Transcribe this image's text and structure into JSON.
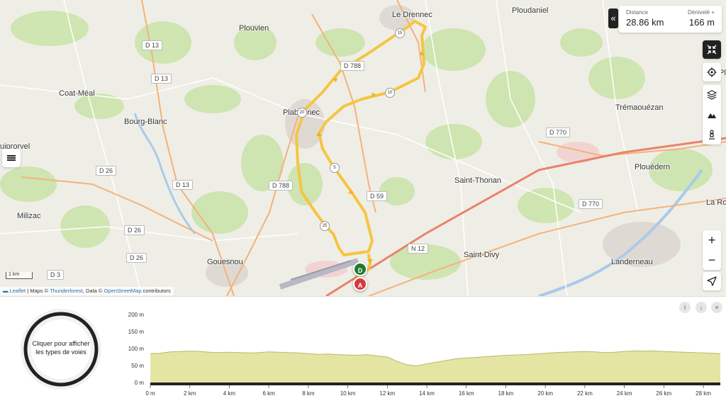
{
  "map": {
    "places": [
      {
        "name": "Le Drennec",
        "cls": "pl-drennec"
      },
      {
        "name": "Ploudaniel",
        "cls": "pl-ploudaniel"
      },
      {
        "name": "Plouvien",
        "cls": "pl-plouvien"
      },
      {
        "name": "Coat-Méal",
        "cls": "pl-coatmeal"
      },
      {
        "name": "Bourg-Blanc",
        "cls": "pl-bourgblanc"
      },
      {
        "name": "uiprorvel",
        "cls": "pl-uiprorvel"
      },
      {
        "name": "Plabennec",
        "cls": "pl-plabennec"
      },
      {
        "name": "Trémaouézan",
        "cls": "pl-tremaouezan"
      },
      {
        "name": "Plouédern",
        "cls": "pl-plouedern"
      },
      {
        "name": "Saint-Thonan",
        "cls": "pl-saintthonan"
      },
      {
        "name": "Milizac",
        "cls": "pl-milizac"
      },
      {
        "name": "Gouesnou",
        "cls": "pl-gouesnou"
      },
      {
        "name": "Saint-Divy",
        "cls": "pl-saintdivy"
      },
      {
        "name": "Landerneau",
        "cls": "pl-landerneau"
      },
      {
        "name": "La Ro",
        "cls": "pl-laro"
      },
      {
        "name": "Pl",
        "cls": "pl-pl"
      }
    ],
    "roads": [
      {
        "ref": "D 13",
        "cls": "rd-1"
      },
      {
        "ref": "D 13",
        "cls": "rd-2"
      },
      {
        "ref": "D 26",
        "cls": "rd-3"
      },
      {
        "ref": "D 13",
        "cls": "rd-4"
      },
      {
        "ref": "D 26",
        "cls": "rd-5"
      },
      {
        "ref": "D 26",
        "cls": "rd-6"
      },
      {
        "ref": "D 3",
        "cls": "rd-7"
      },
      {
        "ref": "D 788",
        "cls": "rd-8"
      },
      {
        "ref": "D 59",
        "cls": "rd-9"
      },
      {
        "ref": "N 12",
        "cls": "rd-10"
      },
      {
        "ref": "D 770",
        "cls": "rd-11"
      },
      {
        "ref": "D 770",
        "cls": "rd-12"
      },
      {
        "ref": "D 788",
        "cls": "rd-13"
      }
    ],
    "km_markers": [
      "5",
      "10",
      "15",
      "20",
      "25"
    ],
    "start_label": "D",
    "end_label": "A",
    "scale_label": "1 km",
    "attribution": {
      "leaflet": "Leaflet",
      "sep1": " | Maps © ",
      "thunderforest": "Thunderforest",
      "sep2": ", Data © ",
      "osm": "OpenStreetMap",
      "tail": " contributors"
    },
    "colors": {
      "route": "#f5c542",
      "start": "#1f7a2e",
      "end": "#d63b3b"
    }
  },
  "stats": {
    "distance_label": "Distance",
    "distance_value": "28.86 km",
    "elevation_label": "Dénivelé +",
    "elevation_value": "166 m"
  },
  "controls": {
    "collapse_icon": "«",
    "fullscreen_icon": "collapse-arrows-icon",
    "settings_icon": "gear-icon",
    "layers_icon": "layers-icon",
    "mountain_icon": "mountain-icon",
    "pegman_icon": "person-icon",
    "zoom_in": "+",
    "zoom_out": "−",
    "menu_icon": "hamburger-icon",
    "locate_icon": "navigation-arrow-icon"
  },
  "panel": {
    "ring_text": "Cliquer pour afficher les types de voies",
    "info_icon": "i",
    "download_icon": "↓",
    "close_icon": "×"
  },
  "chart_data": {
    "type": "area",
    "title": "",
    "xlabel": "",
    "ylabel": "",
    "ylim": [
      0,
      200
    ],
    "yticks": [
      "0 m",
      "50 m",
      "100 m",
      "150 m",
      "200 m"
    ],
    "xlim": [
      0,
      28.86
    ],
    "xticks": [
      "0 m",
      "2 km",
      "4 km",
      "6 km",
      "8 km",
      "10 km",
      "12 km",
      "14 km",
      "16 km",
      "18 km",
      "20 km",
      "22 km",
      "24 km",
      "26 km",
      "28 km"
    ],
    "x": [
      0,
      0.5,
      1,
      1.5,
      2,
      2.5,
      3,
      3.5,
      4,
      4.5,
      5,
      5.5,
      6,
      6.5,
      7,
      7.5,
      8,
      8.5,
      9,
      9.5,
      10,
      10.5,
      11,
      11.5,
      12,
      12.5,
      13,
      13.5,
      14,
      14.5,
      15,
      15.5,
      16,
      16.5,
      17,
      17.5,
      18,
      18.5,
      19,
      19.5,
      20,
      20.5,
      21,
      21.5,
      22,
      22.5,
      23,
      23.5,
      24,
      24.5,
      25,
      25.5,
      26,
      26.5,
      27,
      27.5,
      28,
      28.5,
      28.86
    ],
    "y": [
      85,
      86,
      90,
      91,
      92,
      91,
      89,
      88,
      89,
      88,
      87,
      88,
      90,
      89,
      88,
      87,
      85,
      83,
      84,
      82,
      81,
      80,
      82,
      78,
      75,
      62,
      52,
      49,
      55,
      60,
      65,
      70,
      72,
      74,
      76,
      78,
      80,
      81,
      82,
      84,
      86,
      88,
      89,
      90,
      91,
      90,
      88,
      89,
      91,
      93,
      92,
      93,
      91,
      90,
      89,
      88,
      87,
      86,
      85
    ],
    "fill": "#e5e5a3",
    "stroke": "#b8b86a"
  }
}
